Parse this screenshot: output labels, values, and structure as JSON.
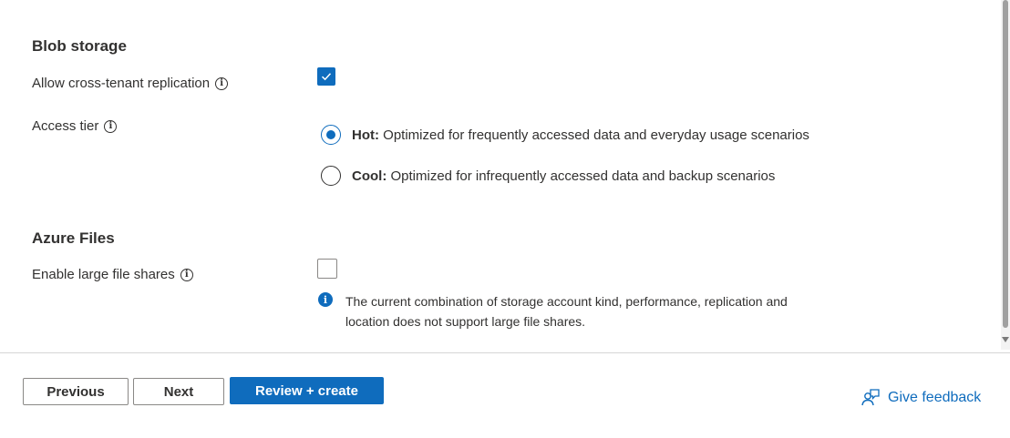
{
  "blob_storage": {
    "title": "Blob storage",
    "cross_tenant": {
      "label": "Allow cross-tenant replication",
      "checked": true,
      "info_icon": "info-icon"
    },
    "access_tier": {
      "label": "Access tier",
      "info_icon": "info-icon",
      "options": [
        {
          "name": "Hot:",
          "description": "Optimized for frequently accessed data and everyday usage scenarios",
          "selected": true
        },
        {
          "name": "Cool:",
          "description": "Optimized for infrequently accessed data and backup scenarios",
          "selected": false
        }
      ]
    }
  },
  "azure_files": {
    "title": "Azure Files",
    "large_file_shares": {
      "label": "Enable large file shares",
      "checked": false,
      "info_icon": "info-icon"
    },
    "note_line1": "The current combination of storage account kind, performance, replication and",
    "note_line2": "location does not support large file shares.",
    "note_icon": "info-filled-icon"
  },
  "footer": {
    "previous_label": "Previous",
    "next_label": "Next",
    "review_label": "Review + create",
    "feedback_label": "Give feedback",
    "feedback_icon": "feedback-person-icon"
  },
  "colors": {
    "accent": "#0f6cbd",
    "text": "#323130",
    "border": "#8a8886"
  }
}
